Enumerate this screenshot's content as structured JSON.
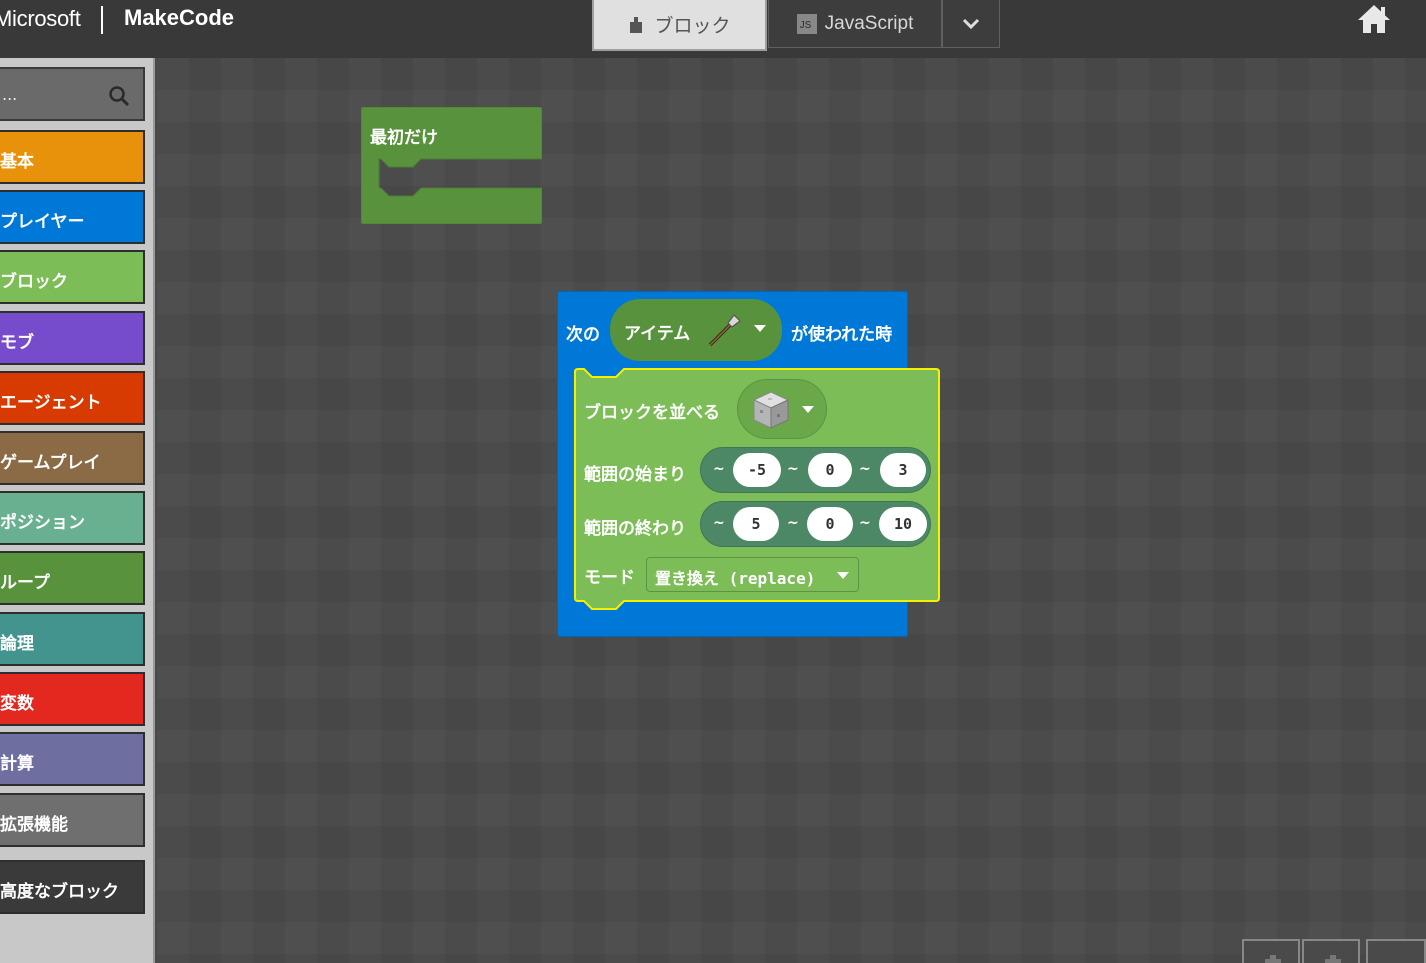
{
  "header": {
    "ms_label": "Microsoft",
    "app_title": "MakeCode",
    "tab_blocks": "ブロック",
    "tab_js": "JavaScript",
    "js_badge": "JS"
  },
  "toolbox": {
    "search_placeholder": "...",
    "categories": [
      {
        "label": "基本",
        "color": "#e8920b"
      },
      {
        "label": "プレイヤー",
        "color": "#0078d7"
      },
      {
        "label": "ブロック",
        "color": "#7cbd57"
      },
      {
        "label": "モブ",
        "color": "#764bcc"
      },
      {
        "label": "エージェント",
        "color": "#d83b01"
      },
      {
        "label": "ゲームプレイ",
        "color": "#8a6b45"
      },
      {
        "label": "ポジション",
        "color": "#69b090"
      },
      {
        "label": "ループ",
        "color": "#59923c"
      },
      {
        "label": "論理",
        "color": "#43948f"
      },
      {
        "label": "変数",
        "color": "#e2281f"
      },
      {
        "label": "計算",
        "color": "#6e6ea1"
      },
      {
        "label": "拡張機能",
        "color": "#6f6f6f"
      },
      {
        "label": "高度なブロック",
        "color": "#3a3a3a"
      }
    ]
  },
  "workspace": {
    "on_start_block": {
      "label": "最初だけ",
      "color": "#59923c"
    },
    "item_used_block": {
      "label_prefix": "次の",
      "item_label": "アイテム",
      "label_suffix": "が使われた時",
      "color": "#0078d7"
    },
    "fill_block": {
      "label": "ブロックを並べる",
      "from_label": "範囲の始まり",
      "from_values": [
        "-5",
        "0",
        "3"
      ],
      "to_label": "範囲の終わり",
      "to_values": [
        "5",
        "0",
        "10"
      ],
      "mode_label": "モード",
      "mode_value": "置き換え (replace)",
      "tilde": "~",
      "color": "#7cbd57"
    }
  }
}
